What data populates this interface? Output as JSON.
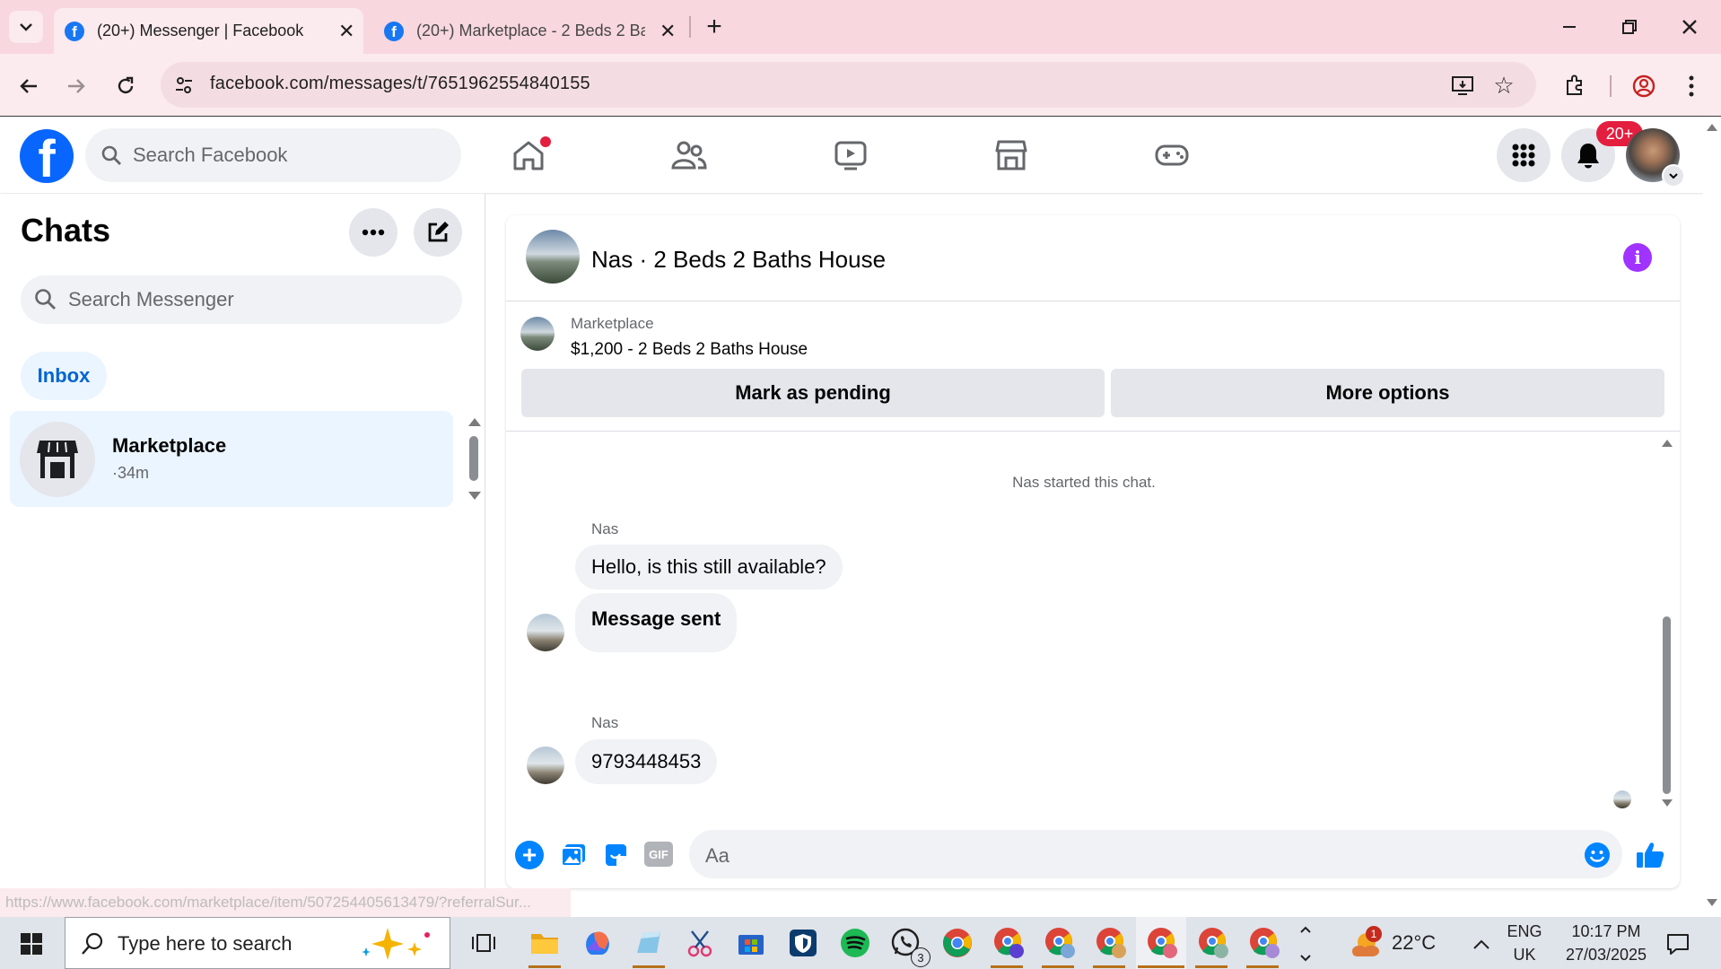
{
  "browser": {
    "tabs": [
      {
        "label": "(20+) Messenger | Facebook",
        "active": true
      },
      {
        "label": "(20+) Marketplace - 2 Beds 2 Ba",
        "active": false
      }
    ],
    "url": "facebook.com/messages/t/7651962554840155",
    "status_url": "https://www.facebook.com/marketplace/item/507254405613479/?referralSur..."
  },
  "fb_header": {
    "logo": "f",
    "search_placeholder": "Search Facebook",
    "notification_badge": "20+"
  },
  "chats": {
    "title": "Chats",
    "search_placeholder": "Search Messenger",
    "filter_pill": "Inbox",
    "conversations": [
      {
        "name": "Marketplace",
        "time": "·34m"
      }
    ]
  },
  "conversation": {
    "title": "Nas · 2 Beds 2 Baths House",
    "item_label": "Marketplace",
    "item_title": "$1,200 - 2 Beds 2 Baths House",
    "mark_pending_label": "Mark as pending",
    "more_options_label": "More options",
    "system_message": "Nas started this chat.",
    "messages": [
      {
        "sender": "Nas",
        "text": "Hello, is this still available?"
      },
      {
        "sender": "",
        "text": "Message sent"
      },
      {
        "sender": "Nas",
        "text": "9793448453"
      }
    ],
    "composer_placeholder": "Aa"
  },
  "taskbar": {
    "search_placeholder": "Type here to search",
    "temperature": "22°C",
    "weather_badge": "1",
    "whatsapp_badge": "3",
    "lang_top": "ENG",
    "lang_bottom": "UK",
    "time": "10:17 PM",
    "date": "27/03/2025"
  },
  "colors": {
    "fb_blue": "#0866ff",
    "messenger_blue": "#0084ff",
    "info_purple": "#a033ff",
    "badge_red": "#e41e3f",
    "tab_strip_pink": "#f8d7de"
  }
}
